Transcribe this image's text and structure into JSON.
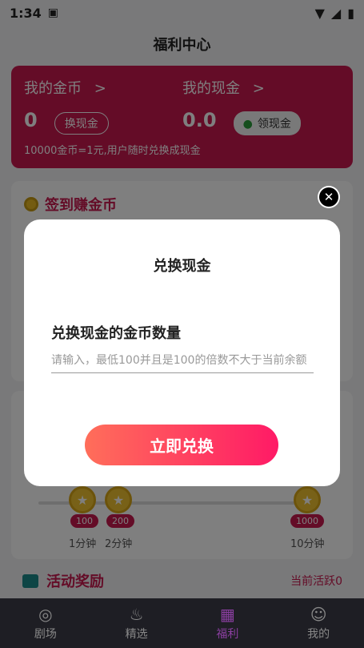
{
  "status": {
    "time": "1:34"
  },
  "header": {
    "title": "福利中心"
  },
  "wallet": {
    "coins_label": "我的金币",
    "coins_arrow": ">",
    "coins_value": "0",
    "exchange_label": "换现金",
    "cash_label": "我的现金",
    "cash_arrow": ">",
    "cash_value": "0.0",
    "claim_label": "领现金",
    "rate_text": "10000金币=1元,用户随时兑换成现金"
  },
  "checkin": {
    "title": "签到赚金币"
  },
  "progress": {
    "nodes": [
      {
        "coins": "100",
        "time": "1分钟"
      },
      {
        "coins": "200",
        "time": "2分钟"
      },
      {
        "coins": "1000",
        "time": "10分钟"
      }
    ]
  },
  "activity": {
    "title": "活动奖励",
    "status": "当前活跃0"
  },
  "modal": {
    "title": "兑换现金",
    "field_label": "兑换现金的金币数量",
    "field_placeholder": "请输入，最低100并且是100的倍数不大于当前余额",
    "submit_label": "立即兑换",
    "close_symbol": "✕"
  },
  "tabbar": {
    "items": [
      {
        "label": "剧场",
        "icon": "theater-icon"
      },
      {
        "label": "精选",
        "icon": "flame-icon"
      },
      {
        "label": "福利",
        "icon": "gift-icon"
      },
      {
        "label": "我的",
        "icon": "user-icon"
      }
    ]
  },
  "colors": {
    "accent": "#c8184f",
    "button_start": "#ff6e5a",
    "button_end": "#ff1a66",
    "tab_active": "#8a3fa0"
  }
}
